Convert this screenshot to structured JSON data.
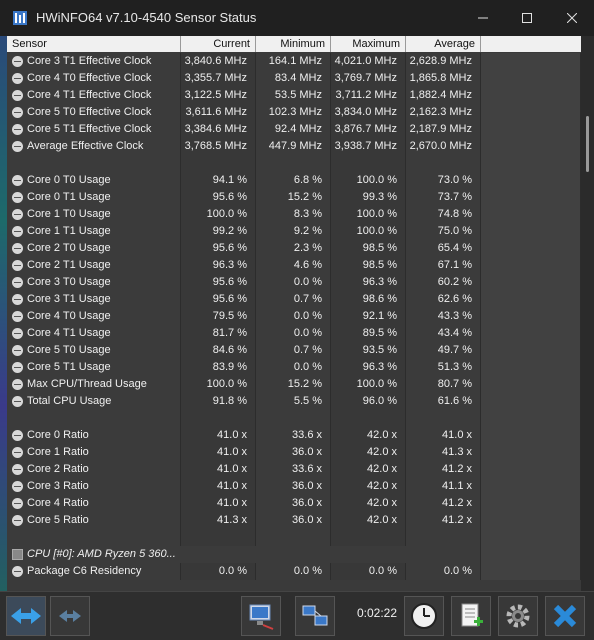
{
  "window": {
    "title": "HWiNFO64 v7.10-4540 Sensor Status"
  },
  "columns": {
    "sensor": "Sensor",
    "current": "Current",
    "minimum": "Minimum",
    "maximum": "Maximum",
    "average": "Average"
  },
  "rows": [
    {
      "name": "Core 3 T1 Effective Clock",
      "current": "3,840.6 MHz",
      "minimum": "164.1 MHz",
      "maximum": "4,021.0 MHz",
      "average": "2,628.9 MHz"
    },
    {
      "name": "Core 4 T0 Effective Clock",
      "current": "3,355.7 MHz",
      "minimum": "83.4 MHz",
      "maximum": "3,769.7 MHz",
      "average": "1,865.8 MHz"
    },
    {
      "name": "Core 4 T1 Effective Clock",
      "current": "3,122.5 MHz",
      "minimum": "53.5 MHz",
      "maximum": "3,711.2 MHz",
      "average": "1,882.4 MHz"
    },
    {
      "name": "Core 5 T0 Effective Clock",
      "current": "3,611.6 MHz",
      "minimum": "102.3 MHz",
      "maximum": "3,834.0 MHz",
      "average": "2,162.3 MHz"
    },
    {
      "name": "Core 5 T1 Effective Clock",
      "current": "3,384.6 MHz",
      "minimum": "92.4 MHz",
      "maximum": "3,876.7 MHz",
      "average": "2,187.9 MHz"
    },
    {
      "name": "Average Effective Clock",
      "current": "3,768.5 MHz",
      "minimum": "447.9 MHz",
      "maximum": "3,938.7 MHz",
      "average": "2,670.0 MHz"
    },
    {
      "gap": true
    },
    {
      "name": "Core 0 T0 Usage",
      "current": "94.1 %",
      "minimum": "6.8 %",
      "maximum": "100.0 %",
      "average": "73.0 %"
    },
    {
      "name": "Core 0 T1 Usage",
      "current": "95.6 %",
      "minimum": "15.2 %",
      "maximum": "99.3 %",
      "average": "73.7 %"
    },
    {
      "name": "Core 1 T0 Usage",
      "current": "100.0 %",
      "minimum": "8.3 %",
      "maximum": "100.0 %",
      "average": "74.8 %"
    },
    {
      "name": "Core 1 T1 Usage",
      "current": "99.2 %",
      "minimum": "9.2 %",
      "maximum": "100.0 %",
      "average": "75.0 %"
    },
    {
      "name": "Core 2 T0 Usage",
      "current": "95.6 %",
      "minimum": "2.3 %",
      "maximum": "98.5 %",
      "average": "65.4 %"
    },
    {
      "name": "Core 2 T1 Usage",
      "current": "96.3 %",
      "minimum": "4.6 %",
      "maximum": "98.5 %",
      "average": "67.1 %"
    },
    {
      "name": "Core 3 T0 Usage",
      "current": "95.6 %",
      "minimum": "0.0 %",
      "maximum": "96.3 %",
      "average": "60.2 %"
    },
    {
      "name": "Core 3 T1 Usage",
      "current": "95.6 %",
      "minimum": "0.7 %",
      "maximum": "98.6 %",
      "average": "62.6 %"
    },
    {
      "name": "Core 4 T0 Usage",
      "current": "79.5 %",
      "minimum": "0.0 %",
      "maximum": "92.1 %",
      "average": "43.3 %"
    },
    {
      "name": "Core 4 T1 Usage",
      "current": "81.7 %",
      "minimum": "0.0 %",
      "maximum": "89.5 %",
      "average": "43.4 %"
    },
    {
      "name": "Core 5 T0 Usage",
      "current": "84.6 %",
      "minimum": "0.7 %",
      "maximum": "93.5 %",
      "average": "49.7 %"
    },
    {
      "name": "Core 5 T1 Usage",
      "current": "83.9 %",
      "minimum": "0.0 %",
      "maximum": "96.3 %",
      "average": "51.3 %"
    },
    {
      "name": "Max CPU/Thread Usage",
      "current": "100.0 %",
      "minimum": "15.2 %",
      "maximum": "100.0 %",
      "average": "80.7 %"
    },
    {
      "name": "Total CPU Usage",
      "current": "91.8 %",
      "minimum": "5.5 %",
      "maximum": "96.0 %",
      "average": "61.6 %"
    },
    {
      "gap": true
    },
    {
      "name": "Core 0 Ratio",
      "current": "41.0 x",
      "minimum": "33.6 x",
      "maximum": "42.0 x",
      "average": "41.0 x"
    },
    {
      "name": "Core 1 Ratio",
      "current": "41.0 x",
      "minimum": "36.0 x",
      "maximum": "42.0 x",
      "average": "41.3 x"
    },
    {
      "name": "Core 2 Ratio",
      "current": "41.0 x",
      "minimum": "33.6 x",
      "maximum": "42.0 x",
      "average": "41.2 x"
    },
    {
      "name": "Core 3 Ratio",
      "current": "41.0 x",
      "minimum": "36.0 x",
      "maximum": "42.0 x",
      "average": "41.1 x"
    },
    {
      "name": "Core 4 Ratio",
      "current": "41.0 x",
      "minimum": "36.0 x",
      "maximum": "42.0 x",
      "average": "41.2 x"
    },
    {
      "name": "Core 5 Ratio",
      "current": "41.3 x",
      "minimum": "36.0 x",
      "maximum": "42.0 x",
      "average": "41.2 x"
    },
    {
      "gap": true
    },
    {
      "group": "CPU [#0]: AMD Ryzen 5 360..."
    },
    {
      "name": "Package C6 Residency",
      "current": "0.0 %",
      "minimum": "0.0 %",
      "maximum": "0.0 %",
      "average": "0.0 %"
    }
  ],
  "toolbar": {
    "timer": "0:02:22",
    "icons": [
      "nav-arrows-icon",
      "nav-arrows-disabled-icon",
      "network-icon",
      "layout-icon",
      "clock-icon",
      "report-icon",
      "settings-gear-icon",
      "close-x-icon"
    ]
  },
  "colors": {
    "background": "#3a3a3a",
    "header_bg": "#f0f0f0",
    "accent_blue": "#2a8ad8"
  }
}
